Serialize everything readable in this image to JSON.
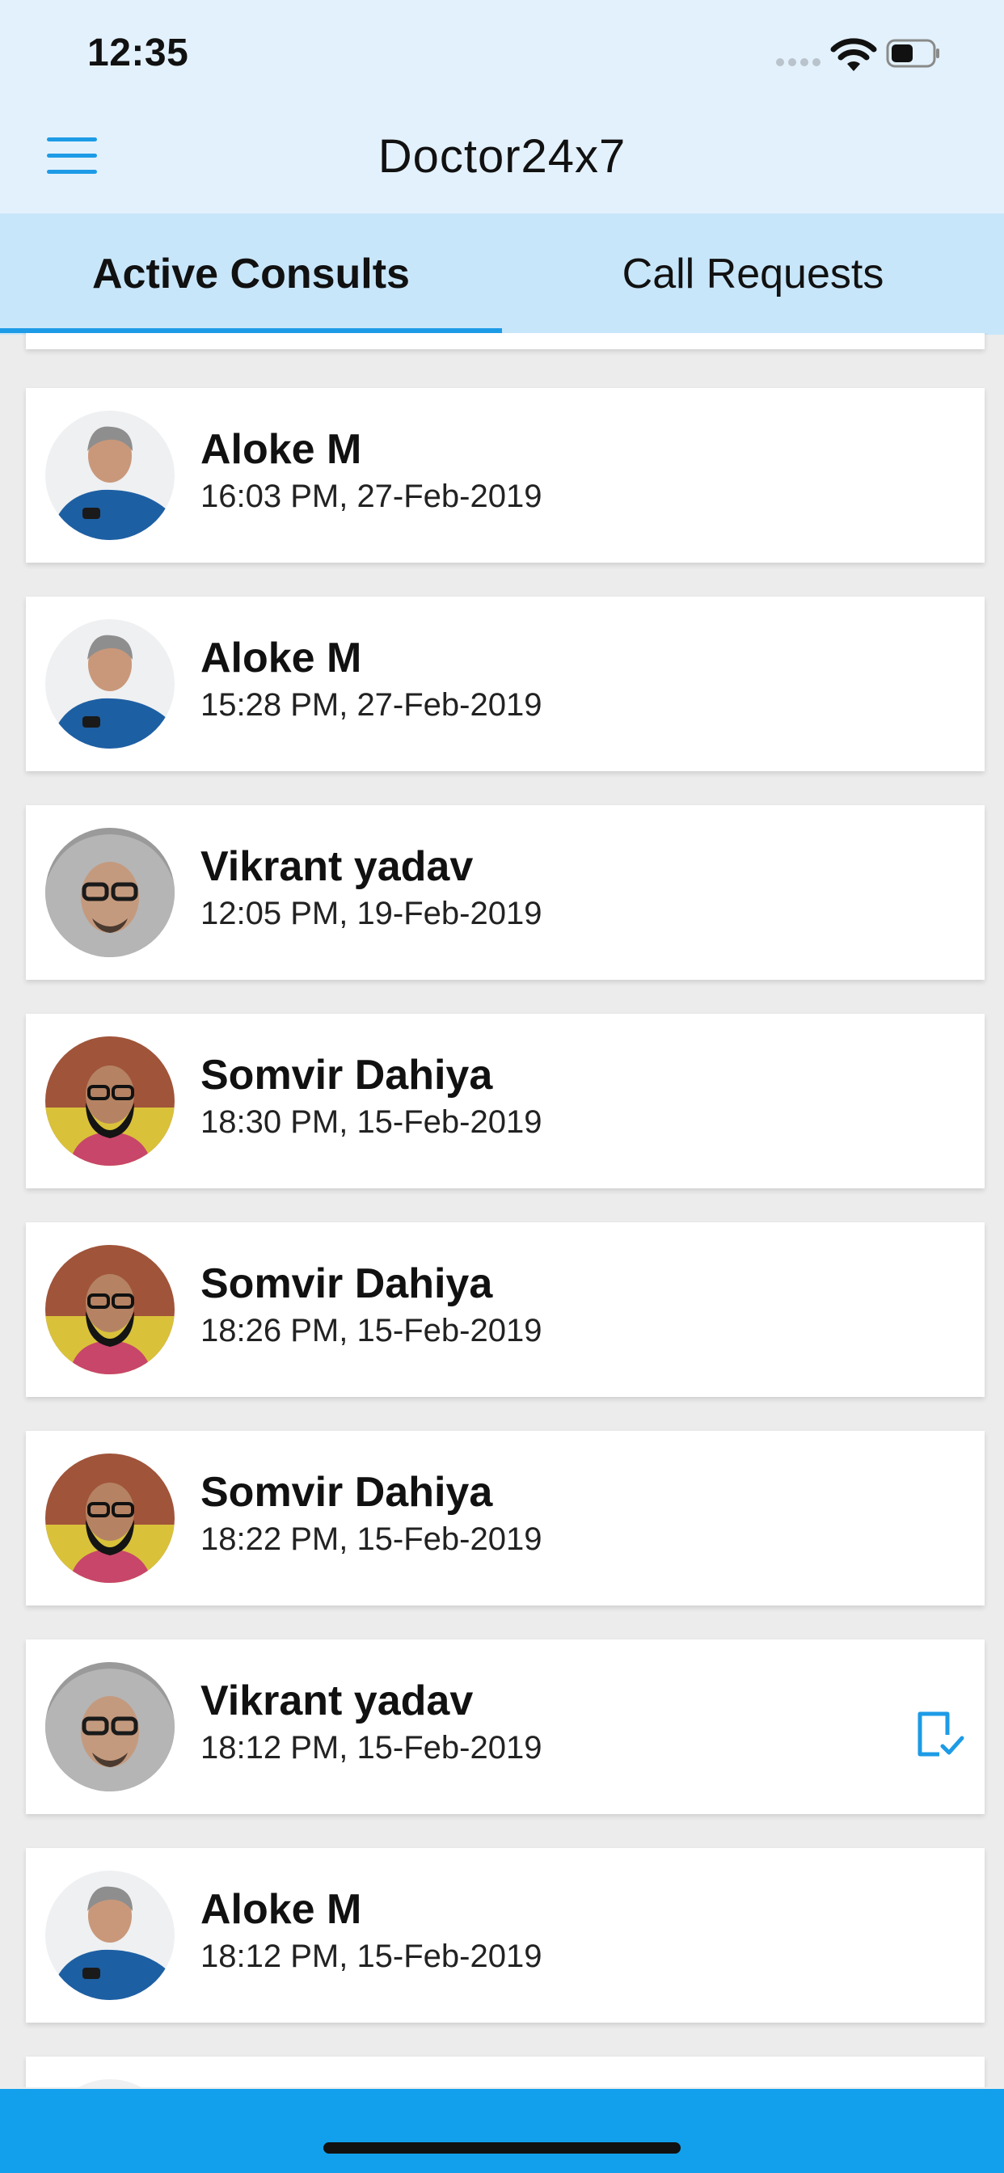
{
  "status_bar": {
    "time": "12:35"
  },
  "header": {
    "title": "Doctor24x7",
    "menu_icon": "hamburger-menu-icon"
  },
  "tabs": [
    {
      "label": "Active Consults",
      "active": true
    },
    {
      "label": "Call Requests",
      "active": false
    }
  ],
  "consults": [
    {
      "name": "Aloke M",
      "time": "16:03 PM, 27-Feb-2019",
      "avatar": "aloke"
    },
    {
      "name": "Aloke M",
      "time": "15:28 PM, 27-Feb-2019",
      "avatar": "aloke"
    },
    {
      "name": "Vikrant yadav",
      "time": "12:05 PM, 19-Feb-2019",
      "avatar": "vikrant"
    },
    {
      "name": "Somvir Dahiya",
      "time": "18:30 PM, 15-Feb-2019",
      "avatar": "somvir"
    },
    {
      "name": "Somvir Dahiya",
      "time": "18:26 PM, 15-Feb-2019",
      "avatar": "somvir"
    },
    {
      "name": "Somvir Dahiya",
      "time": "18:22 PM, 15-Feb-2019",
      "avatar": "somvir"
    },
    {
      "name": "Vikrant yadav",
      "time": "18:12 PM, 15-Feb-2019",
      "avatar": "vikrant",
      "action_icon": "document-check-icon"
    },
    {
      "name": "Aloke M",
      "time": "18:12 PM, 15-Feb-2019",
      "avatar": "aloke"
    }
  ],
  "colors": {
    "accent": "#1d9be6",
    "header_bg": "#e3f1fc",
    "tabs_bg": "#c8e6fa",
    "bottom_bar": "#12a0ec"
  }
}
